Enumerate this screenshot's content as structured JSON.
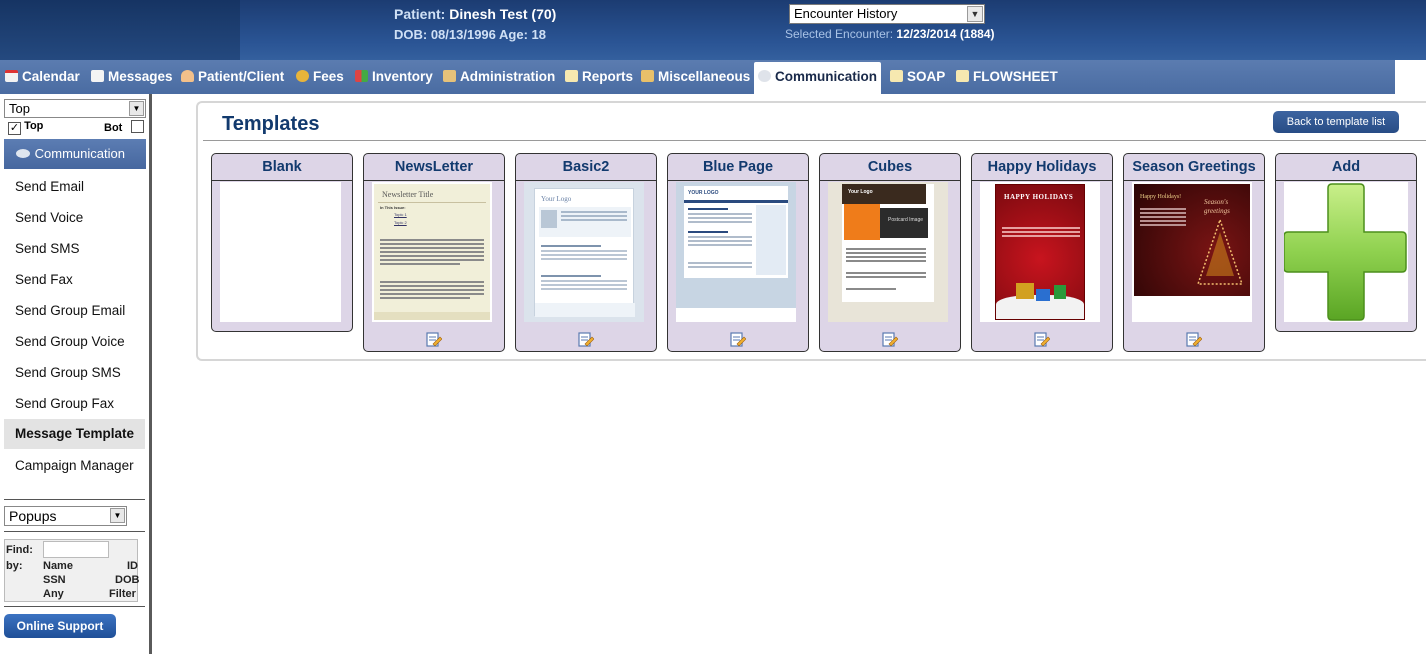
{
  "header": {
    "patient_label": "Patient:",
    "patient_name": "Dinesh Test (70)",
    "dob_line": "DOB: 08/13/1996 Age: 18",
    "encounter_select": "Encounter History",
    "selected_encounter_label": "Selected Encounter:",
    "selected_encounter_value": "12/23/2014 (1884)"
  },
  "nav": {
    "tabs": [
      {
        "label": "Calendar",
        "icon": "calendar-icon"
      },
      {
        "label": "Messages",
        "icon": "envelope-icon"
      },
      {
        "label": "Patient/Client",
        "icon": "person-icon"
      },
      {
        "label": "Fees",
        "icon": "coins-icon"
      },
      {
        "label": "Inventory",
        "icon": "boxes-icon"
      },
      {
        "label": "Administration",
        "icon": "admin-icon"
      },
      {
        "label": "Reports",
        "icon": "report-icon"
      },
      {
        "label": "Miscellaneous",
        "icon": "misc-icon"
      },
      {
        "label": "Communication",
        "icon": "communication-icon"
      },
      {
        "label": "SOAP",
        "icon": "soap-icon"
      },
      {
        "label": "FLOWSHEET",
        "icon": "flowsheet-icon"
      }
    ],
    "active": "Communication"
  },
  "sidebar": {
    "top_select": "Top",
    "top_label": "Top",
    "bot_label": "Bot",
    "section": "Communication",
    "items": [
      "Send Email",
      "Send Voice",
      "Send SMS",
      "Send Fax",
      "Send Group Email",
      "Send Group Voice",
      "Send Group SMS",
      "Send Group Fax",
      "Message Template",
      "Campaign Manager"
    ],
    "active_item": "Message Template",
    "popups_select": "Popups",
    "find": {
      "find_label": "Find:",
      "by_label": "by:",
      "name": "Name",
      "id": "ID",
      "ssn": "SSN",
      "dob": "DOB",
      "any": "Any",
      "filter": "Filter"
    },
    "support_button": "Online Support"
  },
  "main": {
    "title": "Templates",
    "back_button": "Back to template list",
    "templates": [
      "Blank",
      "NewsLetter",
      "Basic2",
      "Blue Page",
      "Cubes",
      "Happy Holidays",
      "Season Greetings",
      "Add"
    ],
    "thumb_text": {
      "newsletter_title": "Newsletter Title",
      "newsletter_in_this_issue": "In This Issue:",
      "newsletter_topic1": "Topic 1",
      "newsletter_topic2": "Topic 2",
      "basic2_logo": "Your Logo",
      "bluepage_logo": "YOUR LOGO",
      "cubes_logo": "Your Logo",
      "cubes_postcard": "Postcard Image",
      "holidays_banner": "HAPPY HOLIDAYS",
      "season_heading": "Happy Holidays!",
      "season_script": "Season's greetings"
    }
  },
  "colors": {
    "header_bg": "#24497f",
    "nav_bg": "#5270a8",
    "card_bg": "#ddd5e7",
    "title_blue": "#123a6e",
    "add_green": "#8fd14f"
  }
}
